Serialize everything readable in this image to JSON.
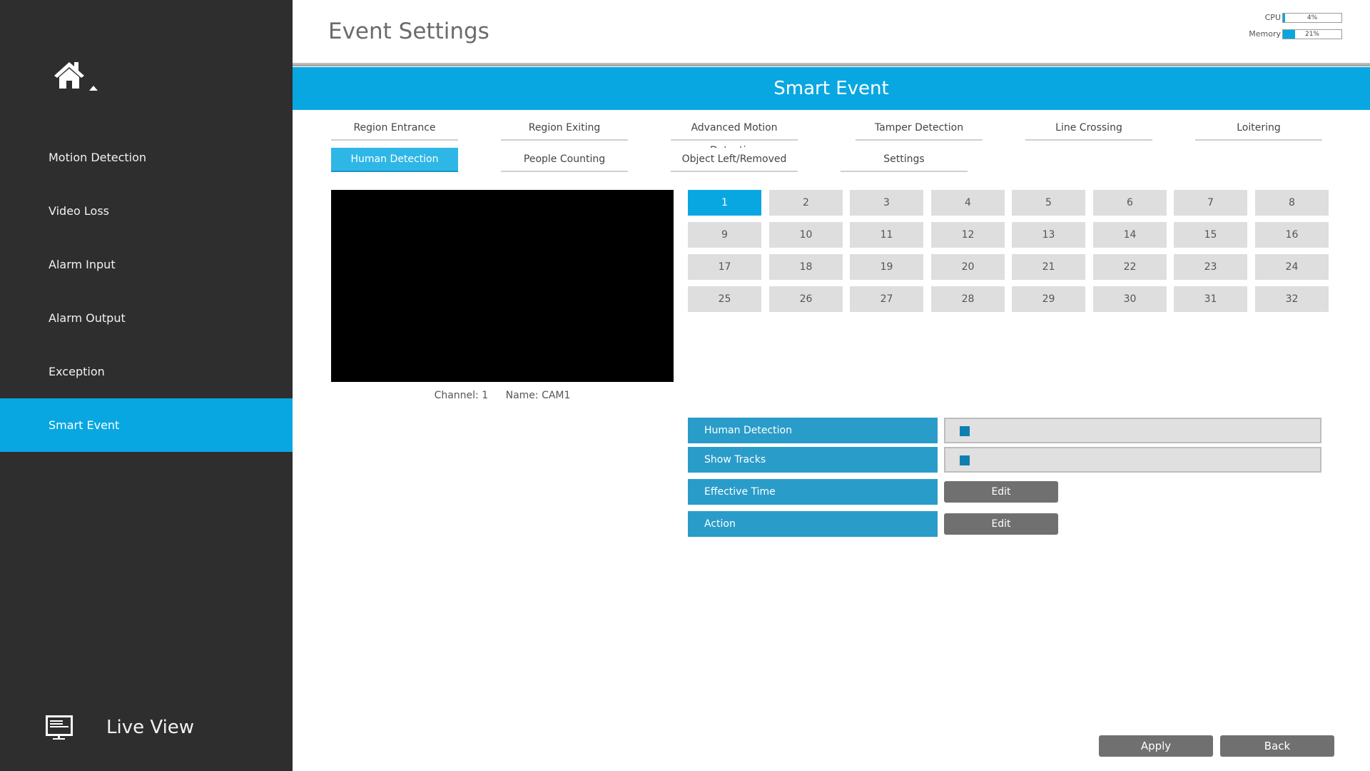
{
  "header": {
    "title": "Event Settings",
    "resources": [
      {
        "label": "CPU",
        "value_text": "4%",
        "percent": 4
      },
      {
        "label": "Memory",
        "value_text": "21%",
        "percent": 21
      }
    ]
  },
  "sidebar": {
    "home_icon": "home-icon",
    "items": [
      {
        "label": "Motion Detection",
        "active": false
      },
      {
        "label": "Video Loss",
        "active": false
      },
      {
        "label": "Alarm Input",
        "active": false
      },
      {
        "label": "Alarm Output",
        "active": false
      },
      {
        "label": "Exception",
        "active": false
      },
      {
        "label": "Smart Event",
        "active": true
      }
    ],
    "live_view": {
      "label": "Live View",
      "icon": "monitor-icon"
    }
  },
  "section": {
    "title": "Smart Event"
  },
  "tabs": [
    {
      "label": "Region Entrance",
      "active": false
    },
    {
      "label": "Region Exiting",
      "active": false
    },
    {
      "label": "Advanced Motion Detection",
      "active": false
    },
    {
      "label": "Tamper Detection",
      "active": false
    },
    {
      "label": "Line Crossing",
      "active": false
    },
    {
      "label": "Loitering",
      "active": false
    },
    {
      "label": "Human Detection",
      "active": true
    },
    {
      "label": "People Counting",
      "active": false
    },
    {
      "label": "Object Left/Removed",
      "active": false
    },
    {
      "label": "Settings",
      "active": false
    }
  ],
  "preview": {
    "channel_text": "Channel: 1",
    "name_text": "Name: CAM1"
  },
  "channels": {
    "selected": 1,
    "labels": [
      "1",
      "2",
      "3",
      "4",
      "5",
      "6",
      "7",
      "8",
      "9",
      "10",
      "11",
      "12",
      "13",
      "14",
      "15",
      "16",
      "17",
      "18",
      "19",
      "20",
      "21",
      "22",
      "23",
      "24",
      "25",
      "26",
      "27",
      "28",
      "29",
      "30",
      "31",
      "32"
    ]
  },
  "settings": {
    "human_detection": {
      "label": "Human Detection",
      "checked": true
    },
    "show_tracks": {
      "label": "Show Tracks",
      "checked": true
    },
    "effective_time": {
      "label": "Effective Time",
      "button": "Edit"
    },
    "action": {
      "label": "Action",
      "button": "Edit"
    }
  },
  "footer": {
    "apply_label": "Apply",
    "back_label": "Back"
  }
}
